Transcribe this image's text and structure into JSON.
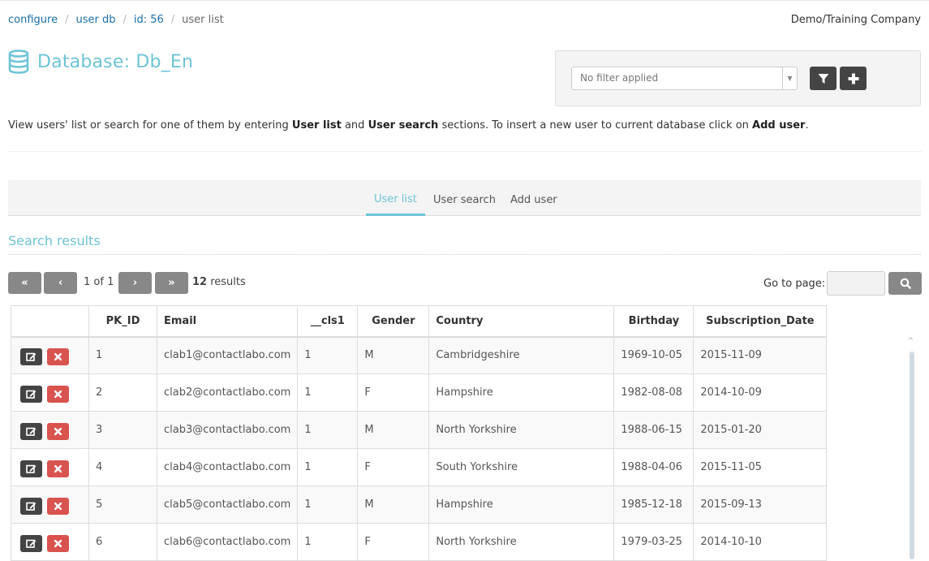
{
  "breadcrumb": [
    {
      "label": "configure",
      "link": true
    },
    {
      "label": "user db",
      "link": true
    },
    {
      "label": "id: 56",
      "link": true
    },
    {
      "label": "user list",
      "link": false
    }
  ],
  "company": "Demo/Training Company",
  "page_title": "Database: Db_En",
  "filter": {
    "placeholder": "No filter applied",
    "filter_button_icon": "filter-icon",
    "add_button_icon": "plus-icon"
  },
  "intro": {
    "part1": "View users' list or search for one of them by entering ",
    "bold1": "User list",
    "part2": " and ",
    "bold2": "User search",
    "part3": " sections. To insert a new user to current database click on ",
    "bold3": "Add user",
    "part4": "."
  },
  "tabs": [
    {
      "label": "User list",
      "active": true
    },
    {
      "label": "User search",
      "active": false
    },
    {
      "label": "Add user",
      "active": false
    }
  ],
  "section_title": "Search results",
  "pager": {
    "first": "«",
    "prev": "‹",
    "page_text": "1 of 1",
    "next": "›",
    "last": "»",
    "results_count": "12",
    "results_label": " results",
    "goto_label": "Go to page:",
    "goto_value": ""
  },
  "table": {
    "headers": [
      "",
      "PK_ID",
      "Email",
      "__cls1",
      "Gender",
      "Country",
      "Birthday",
      "Subscription_Date"
    ],
    "rows": [
      {
        "id": "1",
        "email": "clab1@contactlabo.com",
        "cls1": "1",
        "gender": "M",
        "country": "Cambridgeshire",
        "birthday": "1969-10-05",
        "subscription": "2015-11-09"
      },
      {
        "id": "2",
        "email": "clab2@contactlabo.com",
        "cls1": "1",
        "gender": "F",
        "country": "Hampshire",
        "birthday": "1982-08-08",
        "subscription": "2014-10-09"
      },
      {
        "id": "3",
        "email": "clab3@contactlabo.com",
        "cls1": "1",
        "gender": "M",
        "country": "North Yorkshire",
        "birthday": "1988-06-15",
        "subscription": "2015-01-20"
      },
      {
        "id": "4",
        "email": "clab4@contactlabo.com",
        "cls1": "1",
        "gender": "F",
        "country": "South Yorkshire",
        "birthday": "1988-04-06",
        "subscription": "2015-11-05"
      },
      {
        "id": "5",
        "email": "clab5@contactlabo.com",
        "cls1": "1",
        "gender": "M",
        "country": "Hampshire",
        "birthday": "1985-12-18",
        "subscription": "2015-09-13"
      },
      {
        "id": "6",
        "email": "clab6@contactlabo.com",
        "cls1": "1",
        "gender": "F",
        "country": "North Yorkshire",
        "birthday": "1979-03-25",
        "subscription": "2014-10-10"
      }
    ]
  },
  "colors": {
    "accent": "#6ec4d6",
    "link": "#1a6fa8",
    "dark_button": "#444444",
    "danger_button": "#d9534f",
    "pager_button": "#888888"
  }
}
